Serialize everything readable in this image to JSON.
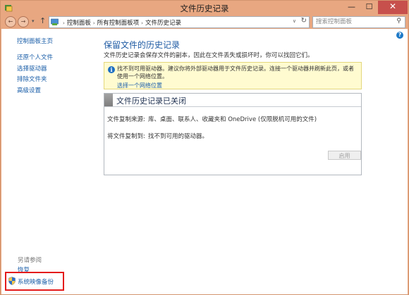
{
  "window": {
    "title": "文件历史记录",
    "minimize_glyph": "—",
    "maximize_glyph": "☐",
    "close_glyph": "✕"
  },
  "nav": {
    "back_glyph": "←",
    "forward_glyph": "→",
    "dropdown_glyph": "▾",
    "up_glyph": "↑",
    "breadcrumbs": [
      "控制面板",
      "所有控制面板项",
      "文件历史记录"
    ],
    "breadcrumb_separator": "›",
    "address_dropdown_glyph": "∨",
    "refresh_glyph": "↻",
    "search_placeholder": "搜索控制面板",
    "search_icon_glyph": "⚲"
  },
  "sidebar": {
    "home": "控制面板主页",
    "items": [
      "还原个人文件",
      "选择驱动器",
      "排除文件夹",
      "高级设置"
    ],
    "see_also_heading": "另请参阅",
    "see_also": [
      "恢复",
      "系统映像备份"
    ]
  },
  "main": {
    "help_glyph": "?",
    "title": "保留文件的历史记录",
    "intro": "文件历史记录会保存文件的副本，因此在文件丢失或损坏时，你可以找回它们。",
    "warning": {
      "icon_glyph": "i",
      "text": "找不到可用驱动器。建议你将外部驱动器用于文件历史记录。连接一个驱动器并刷新此页，或者使用一个网络位置。",
      "link": "选择一个网络位置"
    },
    "status": {
      "title": "文件历史记录已关闭",
      "copy_from_label": "文件复制来源:",
      "copy_from_value": "库、桌面、联系人、收藏夹和 OneDrive (仅限脱机可用的文件)",
      "copy_to_label": "将文件复制到:",
      "copy_to_value": "找不到可用的驱动器。"
    },
    "enable_button": "启用"
  },
  "colors": {
    "title_bar": "#e8a781",
    "link": "#1a5ea8",
    "heading": "#1e5aa3",
    "warning_bg": "#fffbd0",
    "highlight_border": "#e41b1b",
    "close_button": "#c7504c"
  },
  "icons": {
    "app": "file-history-icon",
    "control_panel": "control-panel-icon",
    "shield": "shield-icon",
    "info": "info-icon",
    "help": "help-icon",
    "search": "search-icon"
  }
}
